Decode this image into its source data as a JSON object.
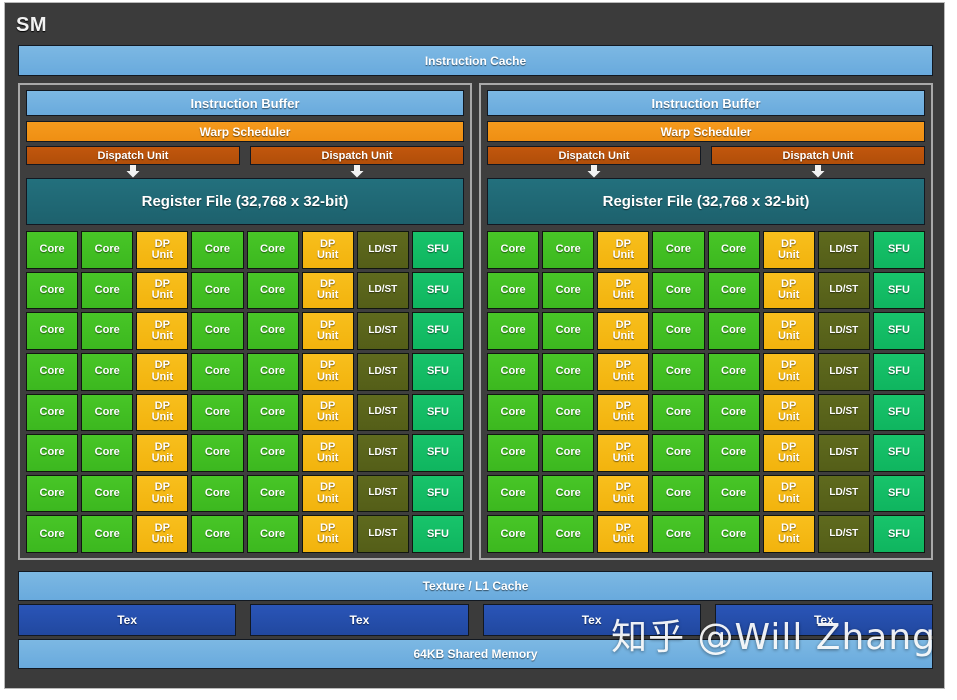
{
  "diagram": {
    "title": "SM",
    "instruction_cache": "Instruction Cache",
    "texture_cache": "Texture / L1 Cache",
    "shared_memory": "64KB Shared Memory",
    "watermark": "知乎 @Will Zhang"
  },
  "processing_blocks": [
    {
      "instruction_buffer": "Instruction Buffer",
      "warp_scheduler": "Warp Scheduler",
      "dispatch_units": [
        "Dispatch Unit",
        "Dispatch Unit"
      ],
      "register_file": "Register File (32,768 x 32-bit)",
      "grid": {
        "rows": 8,
        "columns": 8,
        "column_types": [
          "core",
          "core",
          "dp",
          "core",
          "core",
          "dp",
          "ldst",
          "sfu"
        ],
        "labels": {
          "core": "Core",
          "dp_line1": "DP",
          "dp_line2": "Unit",
          "ldst": "LD/ST",
          "sfu": "SFU"
        }
      }
    },
    {
      "instruction_buffer": "Instruction Buffer",
      "warp_scheduler": "Warp Scheduler",
      "dispatch_units": [
        "Dispatch Unit",
        "Dispatch Unit"
      ],
      "register_file": "Register File (32,768 x 32-bit)",
      "grid": {
        "rows": 8,
        "columns": 8,
        "column_types": [
          "core",
          "core",
          "dp",
          "core",
          "core",
          "dp",
          "ldst",
          "sfu"
        ],
        "labels": {
          "core": "Core",
          "dp_line1": "DP",
          "dp_line2": "Unit",
          "ldst": "LD/ST",
          "sfu": "SFU"
        }
      }
    }
  ],
  "texture_units": [
    "Tex",
    "Tex",
    "Tex",
    "Tex"
  ],
  "colors": {
    "panel_background": "#3b3b3b",
    "cache_blue": "#69aadd",
    "warp_scheduler_orange": "#ef8f13",
    "dispatch_unit_orange": "#b14e09",
    "register_file_teal": "#1d616d",
    "core_green": "#3cb81f",
    "dp_unit_amber": "#f2b30d",
    "ldst_olive": "#545e18",
    "sfu_green": "#0fb55f",
    "tex_blue": "#21489f"
  }
}
